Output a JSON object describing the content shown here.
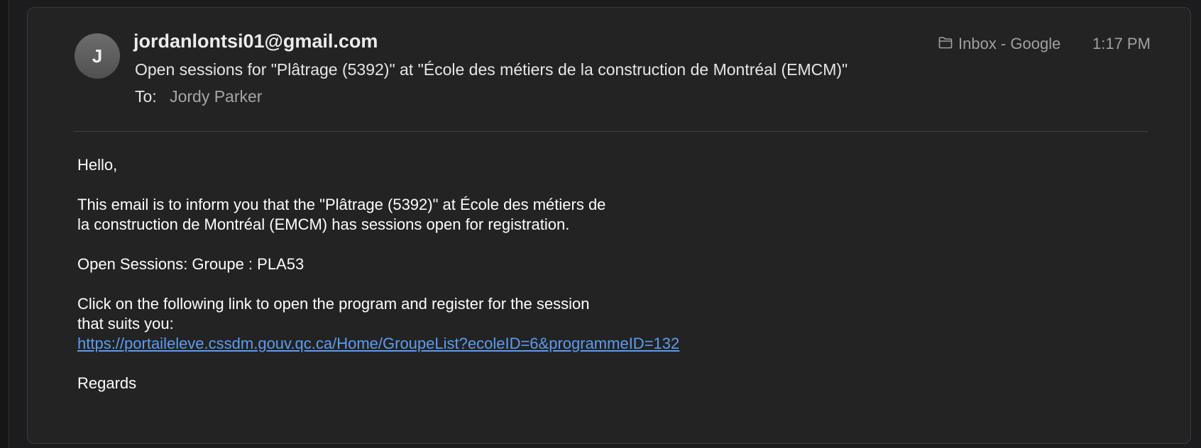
{
  "email": {
    "avatar_initial": "J",
    "sender": "jordanlontsi01@gmail.com",
    "subject": "Open sessions for \"Plâtrage (5392)\" at \"École des métiers de la construction de Montréal (EMCM)\"",
    "to_label": "To:",
    "to_name": "Jordy Parker",
    "mailbox_icon": "folder-icon",
    "mailbox": "Inbox - Google",
    "time": "1:17 PM"
  },
  "body": {
    "greeting": "Hello,",
    "paragraph1": "This email is to inform you that the \"Plâtrage (5392)\" at École des métiers de la construction de Montréal (EMCM) has sessions open for registration.",
    "open_sessions": "Open Sessions: Groupe : PLA53",
    "paragraph2": "Click on the following link to open the program and register for the session that suits you:",
    "link": "https://portaileleve.cssdm.gouv.qc.ca/Home/GroupeList?ecoleID=6&programmeID=132",
    "signoff": "Regards"
  },
  "colors": {
    "background": "#232323",
    "link": "#5b9cf2",
    "muted_text": "#a0a0a0"
  }
}
